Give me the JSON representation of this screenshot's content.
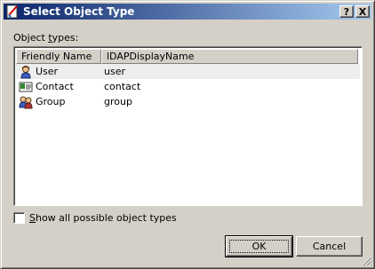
{
  "window": {
    "title": "Select Object Type",
    "help_label": "?",
    "close_label": "X"
  },
  "object_types_label": {
    "before": "Object ",
    "underlined": "t",
    "after": "ypes:"
  },
  "list": {
    "columns": [
      "Friendly Name",
      "lDAPDisplayName"
    ],
    "rows": [
      {
        "friendly": "User",
        "ldap": "user",
        "icon": "user-icon",
        "selected": true
      },
      {
        "friendly": "Contact",
        "ldap": "contact",
        "icon": "contact-icon",
        "selected": false
      },
      {
        "friendly": "Group",
        "ldap": "group",
        "icon": "group-icon",
        "selected": false
      }
    ]
  },
  "show_all": {
    "underlined": "S",
    "rest": "how all possible object types",
    "checked": false
  },
  "buttons": {
    "ok": "OK",
    "cancel": "Cancel"
  },
  "colors": {
    "title_start": "#0a246a",
    "title_end": "#a6caf0",
    "face": "#d4d0c8"
  }
}
